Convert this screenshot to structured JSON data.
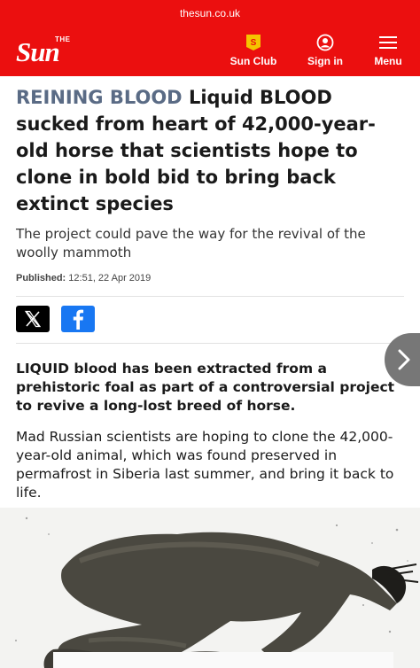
{
  "browser": {
    "url": "thesun.co.uk"
  },
  "header": {
    "logo_the": "THE",
    "logo_sun": "Sun",
    "nav": [
      {
        "label": "Sun Club",
        "icon": "sun-club-icon"
      },
      {
        "label": "Sign in",
        "icon": "user-icon"
      },
      {
        "label": "Menu",
        "icon": "hamburger-icon"
      }
    ],
    "colors": {
      "brand_red": "#eb0f0f",
      "kicker": "#5a6b85"
    }
  },
  "article": {
    "kicker": "REINING BLOOD",
    "headline": "Liquid BLOOD sucked from heart of 42,000-year-old horse that scientists hope to clone in bold bid to bring back extinct species",
    "standfirst": "The project could pave the way for the revival of the woolly mammoth",
    "published_label": "Published:",
    "published_value": "12:51, 22 Apr 2019",
    "share": [
      {
        "network": "X",
        "icon": "x-logo-icon"
      },
      {
        "network": "Facebook",
        "icon": "facebook-icon"
      }
    ],
    "lede": "LIQUID blood has been extracted from a prehistoric foal as part of a controversial project to revive a long-lost breed of horse.",
    "paragraphs": [
      "Mad Russian scientists are hoping to clone the 42,000-year-old animal, which was found preserved in permafrost in Siberia last summer, and bring it back to life."
    ]
  }
}
